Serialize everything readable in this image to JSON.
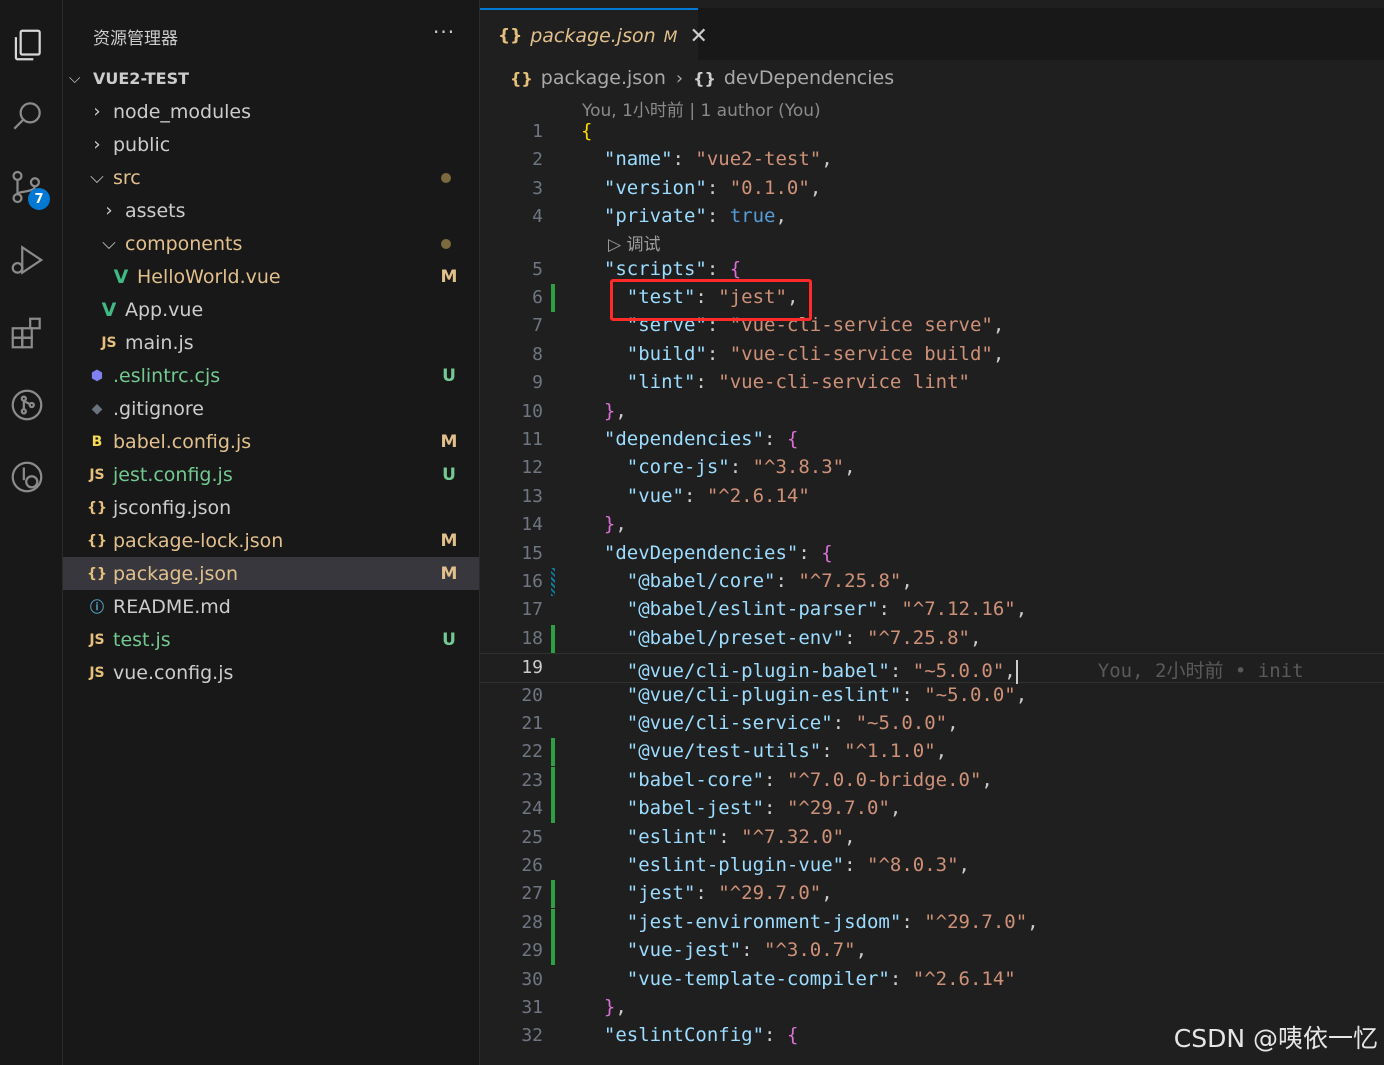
{
  "sidebar": {
    "title": "资源管理器",
    "more": "···",
    "root": "VUE2-TEST",
    "items": [
      {
        "label": "node_modules",
        "kind": "folder",
        "expanded": false,
        "depth": 1
      },
      {
        "label": "public",
        "kind": "folder",
        "expanded": false,
        "depth": 1
      },
      {
        "label": "src",
        "kind": "folder",
        "expanded": true,
        "depth": 1,
        "dot": true
      },
      {
        "label": "assets",
        "kind": "folder",
        "expanded": false,
        "depth": 2
      },
      {
        "label": "components",
        "kind": "folder",
        "expanded": true,
        "depth": 2,
        "dot": true
      },
      {
        "label": "HelloWorld.vue",
        "kind": "vue",
        "depth": 3,
        "status": "M"
      },
      {
        "label": "App.vue",
        "kind": "vue",
        "depth": 2
      },
      {
        "label": "main.js",
        "kind": "js",
        "depth": 2
      },
      {
        "label": ".eslintrc.cjs",
        "kind": "eslint",
        "depth": 1,
        "status": "U"
      },
      {
        "label": ".gitignore",
        "kind": "git",
        "depth": 1
      },
      {
        "label": "babel.config.js",
        "kind": "babel",
        "depth": 1,
        "status": "M"
      },
      {
        "label": "jest.config.js",
        "kind": "js",
        "depth": 1,
        "status": "U"
      },
      {
        "label": "jsconfig.json",
        "kind": "json",
        "depth": 1
      },
      {
        "label": "package-lock.json",
        "kind": "json",
        "depth": 1,
        "status": "M"
      },
      {
        "label": "package.json",
        "kind": "json",
        "depth": 1,
        "status": "M",
        "selected": true
      },
      {
        "label": "README.md",
        "kind": "info",
        "depth": 1
      },
      {
        "label": "test.js",
        "kind": "js",
        "depth": 1,
        "status": "U"
      },
      {
        "label": "vue.config.js",
        "kind": "js",
        "depth": 1
      }
    ]
  },
  "activity": {
    "source_control_badge": "7"
  },
  "tab": {
    "name": "package.json",
    "modified": "M"
  },
  "breadcrumb": {
    "file": "package.json",
    "symbol": "devDependencies"
  },
  "codelens": {
    "blame_header": "You, 1小时前 | 1 author (You)",
    "debug": "调试"
  },
  "inline_blame": "You, 2小时前 • init",
  "code_lines": [
    {
      "n": "1",
      "parts": [
        [
          "br1",
          "{"
        ]
      ]
    },
    {
      "n": "2",
      "parts": [
        [
          "p",
          "  "
        ],
        [
          "k",
          "\"name\""
        ],
        [
          "p",
          ": "
        ],
        [
          "s",
          "\"vue2-test\""
        ],
        [
          "p",
          ","
        ]
      ]
    },
    {
      "n": "3",
      "parts": [
        [
          "p",
          "  "
        ],
        [
          "k",
          "\"version\""
        ],
        [
          "p",
          ": "
        ],
        [
          "s",
          "\"0.1.0\""
        ],
        [
          "p",
          ","
        ]
      ]
    },
    {
      "n": "4",
      "parts": [
        [
          "p",
          "  "
        ],
        [
          "k",
          "\"private\""
        ],
        [
          "p",
          ": "
        ],
        [
          "b",
          "true"
        ],
        [
          "p",
          ","
        ]
      ]
    },
    {
      "n": "5",
      "parts": [
        [
          "p",
          "  "
        ],
        [
          "k",
          "\"scripts\""
        ],
        [
          "p",
          ": "
        ],
        [
          "br2",
          "{"
        ]
      ]
    },
    {
      "n": "6",
      "parts": [
        [
          "p",
          "    "
        ],
        [
          "k",
          "\"test\""
        ],
        [
          "p",
          ": "
        ],
        [
          "s",
          "\"jest\""
        ],
        [
          "p",
          ","
        ]
      ],
      "gutter": "add"
    },
    {
      "n": "7",
      "parts": [
        [
          "p",
          "    "
        ],
        [
          "k",
          "\"serve\""
        ],
        [
          "p",
          ": "
        ],
        [
          "s",
          "\"vue-cli-service serve\""
        ],
        [
          "p",
          ","
        ]
      ]
    },
    {
      "n": "8",
      "parts": [
        [
          "p",
          "    "
        ],
        [
          "k",
          "\"build\""
        ],
        [
          "p",
          ": "
        ],
        [
          "s",
          "\"vue-cli-service build\""
        ],
        [
          "p",
          ","
        ]
      ]
    },
    {
      "n": "9",
      "parts": [
        [
          "p",
          "    "
        ],
        [
          "k",
          "\"lint\""
        ],
        [
          "p",
          ": "
        ],
        [
          "s",
          "\"vue-cli-service lint\""
        ]
      ]
    },
    {
      "n": "10",
      "parts": [
        [
          "p",
          "  "
        ],
        [
          "br2",
          "}"
        ],
        [
          "p",
          ","
        ]
      ]
    },
    {
      "n": "11",
      "parts": [
        [
          "p",
          "  "
        ],
        [
          "k",
          "\"dependencies\""
        ],
        [
          "p",
          ": "
        ],
        [
          "br2",
          "{"
        ]
      ]
    },
    {
      "n": "12",
      "parts": [
        [
          "p",
          "    "
        ],
        [
          "k",
          "\"core-js\""
        ],
        [
          "p",
          ": "
        ],
        [
          "s",
          "\"^3.8.3\""
        ],
        [
          "p",
          ","
        ]
      ]
    },
    {
      "n": "13",
      "parts": [
        [
          "p",
          "    "
        ],
        [
          "k",
          "\"vue\""
        ],
        [
          "p",
          ": "
        ],
        [
          "s",
          "\"^2.6.14\""
        ]
      ]
    },
    {
      "n": "14",
      "parts": [
        [
          "p",
          "  "
        ],
        [
          "br2",
          "}"
        ],
        [
          "p",
          ","
        ]
      ]
    },
    {
      "n": "15",
      "parts": [
        [
          "p",
          "  "
        ],
        [
          "k",
          "\"devDependencies\""
        ],
        [
          "p",
          ": "
        ],
        [
          "br2",
          "{"
        ]
      ]
    },
    {
      "n": "16",
      "parts": [
        [
          "p",
          "    "
        ],
        [
          "k",
          "\"@babel/core\""
        ],
        [
          "p",
          ": "
        ],
        [
          "s",
          "\"^7.25.8\""
        ],
        [
          "p",
          ","
        ]
      ],
      "gutter": "modi"
    },
    {
      "n": "17",
      "parts": [
        [
          "p",
          "    "
        ],
        [
          "k",
          "\"@babel/eslint-parser\""
        ],
        [
          "p",
          ": "
        ],
        [
          "s",
          "\"^7.12.16\""
        ],
        [
          "p",
          ","
        ]
      ]
    },
    {
      "n": "18",
      "parts": [
        [
          "p",
          "    "
        ],
        [
          "k",
          "\"@babel/preset-env\""
        ],
        [
          "p",
          ": "
        ],
        [
          "s",
          "\"^7.25.8\""
        ],
        [
          "p",
          ","
        ]
      ],
      "gutter": "add"
    },
    {
      "n": "19",
      "parts": [
        [
          "p",
          "    "
        ],
        [
          "k",
          "\"@vue/cli-plugin-babel\""
        ],
        [
          "p",
          ": "
        ],
        [
          "s",
          "\"~5.0.0\""
        ],
        [
          "p",
          ","
        ]
      ],
      "current": true
    },
    {
      "n": "20",
      "parts": [
        [
          "p",
          "    "
        ],
        [
          "k",
          "\"@vue/cli-plugin-eslint\""
        ],
        [
          "p",
          ": "
        ],
        [
          "s",
          "\"~5.0.0\""
        ],
        [
          "p",
          ","
        ]
      ]
    },
    {
      "n": "21",
      "parts": [
        [
          "p",
          "    "
        ],
        [
          "k",
          "\"@vue/cli-service\""
        ],
        [
          "p",
          ": "
        ],
        [
          "s",
          "\"~5.0.0\""
        ],
        [
          "p",
          ","
        ]
      ]
    },
    {
      "n": "22",
      "parts": [
        [
          "p",
          "    "
        ],
        [
          "k",
          "\"@vue/test-utils\""
        ],
        [
          "p",
          ": "
        ],
        [
          "s",
          "\"^1.1.0\""
        ],
        [
          "p",
          ","
        ]
      ],
      "gutter": "add"
    },
    {
      "n": "23",
      "parts": [
        [
          "p",
          "    "
        ],
        [
          "k",
          "\"babel-core\""
        ],
        [
          "p",
          ": "
        ],
        [
          "s",
          "\"^7.0.0-bridge.0\""
        ],
        [
          "p",
          ","
        ]
      ],
      "gutter": "add"
    },
    {
      "n": "24",
      "parts": [
        [
          "p",
          "    "
        ],
        [
          "k",
          "\"babel-jest\""
        ],
        [
          "p",
          ": "
        ],
        [
          "s",
          "\"^29.7.0\""
        ],
        [
          "p",
          ","
        ]
      ],
      "gutter": "add"
    },
    {
      "n": "25",
      "parts": [
        [
          "p",
          "    "
        ],
        [
          "k",
          "\"eslint\""
        ],
        [
          "p",
          ": "
        ],
        [
          "s",
          "\"^7.32.0\""
        ],
        [
          "p",
          ","
        ]
      ]
    },
    {
      "n": "26",
      "parts": [
        [
          "p",
          "    "
        ],
        [
          "k",
          "\"eslint-plugin-vue\""
        ],
        [
          "p",
          ": "
        ],
        [
          "s",
          "\"^8.0.3\""
        ],
        [
          "p",
          ","
        ]
      ]
    },
    {
      "n": "27",
      "parts": [
        [
          "p",
          "    "
        ],
        [
          "k",
          "\"jest\""
        ],
        [
          "p",
          ": "
        ],
        [
          "s",
          "\"^29.7.0\""
        ],
        [
          "p",
          ","
        ]
      ],
      "gutter": "add"
    },
    {
      "n": "28",
      "parts": [
        [
          "p",
          "    "
        ],
        [
          "k",
          "\"jest-environment-jsdom\""
        ],
        [
          "p",
          ": "
        ],
        [
          "s",
          "\"^29.7.0\""
        ],
        [
          "p",
          ","
        ]
      ],
      "gutter": "add"
    },
    {
      "n": "29",
      "parts": [
        [
          "p",
          "    "
        ],
        [
          "k",
          "\"vue-jest\""
        ],
        [
          "p",
          ": "
        ],
        [
          "s",
          "\"^3.0.7\""
        ],
        [
          "p",
          ","
        ]
      ],
      "gutter": "add"
    },
    {
      "n": "30",
      "parts": [
        [
          "p",
          "    "
        ],
        [
          "k",
          "\"vue-template-compiler\""
        ],
        [
          "p",
          ": "
        ],
        [
          "s",
          "\"^2.6.14\""
        ]
      ]
    },
    {
      "n": "31",
      "parts": [
        [
          "p",
          "  "
        ],
        [
          "br2",
          "}"
        ],
        [
          "p",
          ","
        ]
      ]
    },
    {
      "n": "32",
      "parts": [
        [
          "p",
          "  "
        ],
        [
          "k",
          "\"eslintConfig\""
        ],
        [
          "p",
          ": "
        ],
        [
          "br2",
          "{"
        ]
      ]
    }
  ],
  "watermark": "CSDN @咦依一忆"
}
